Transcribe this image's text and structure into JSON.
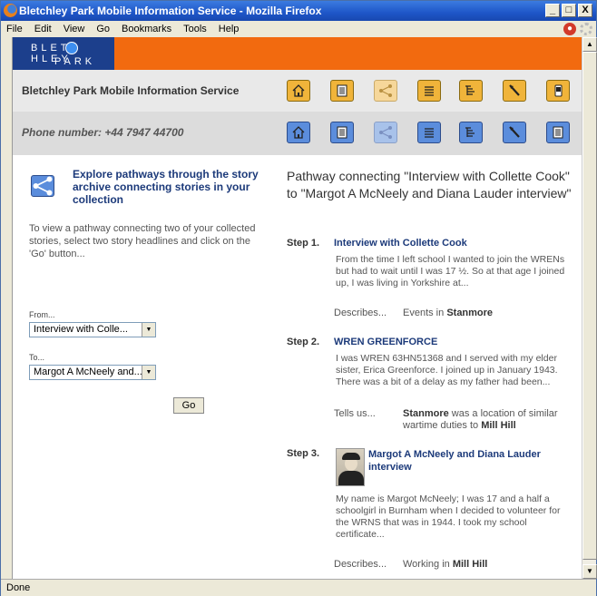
{
  "window": {
    "title": "Bletchley Park Mobile Information Service - Mozilla Firefox",
    "buttons": [
      "_",
      "□",
      "X"
    ]
  },
  "menu": [
    "File",
    "Edit",
    "View",
    "Go",
    "Bookmarks",
    "Tools",
    "Help"
  ],
  "status": "Done",
  "logo": {
    "line1": "BLET",
    "line1b": "HLEY",
    "line2": "PARK"
  },
  "header": {
    "service_name": "Bletchley Park Mobile Information Service",
    "phone": "Phone number: +44 7947 44700"
  },
  "nav_icons": [
    "home-icon",
    "document-icon",
    "pathway-icon",
    "list-icon",
    "tree-icon",
    "pointer-icon",
    "mobile-icon"
  ],
  "left": {
    "heading": "Explore pathways through the story archive connecting stories in your collection",
    "description": "To view a pathway connecting two of your collected stories, select two story headlines and click on the 'Go' button...",
    "from_label": "From...",
    "from_value": "Interview with Colle...",
    "to_label": "To...",
    "to_value": "Margot A McNeely and...",
    "go_label": "Go"
  },
  "right": {
    "title": "Pathway connecting \"Interview with Collette Cook\" to \"Margot A McNeely and Diana Lauder interview\"",
    "steps": [
      {
        "num": "Step 1.",
        "title": "Interview with Collette Cook",
        "body": "From the time I left school I wanted to join the WRENs but had to wait until I was 17 ½. So at that age I joined up, I was living in Yorkshire at...",
        "rel_verb": "Describes...",
        "rel_text": "Events in ",
        "rel_place": "Stanmore"
      },
      {
        "num": "Step 2.",
        "title": "WREN GREENFORCE",
        "body": "I was WREN 63HN51368 and I served with my elder sister, Erica Greenforce. I joined up in January 1943. There was a bit of a delay as my father had been...",
        "rel_verb": "Tells us...",
        "rel_place": "Stanmore",
        "rel_text": " was a location of similar wartime duties to ",
        "rel_place2": "Mill Hill"
      },
      {
        "num": "Step 3.",
        "title": "Margot A McNeely and Diana Lauder interview",
        "body": "My name is Margot McNeely; I was 17 and a half a schoolgirl in Burnham when I decided to volunteer for the WRNS that was in 1944. I took my school certificate...",
        "rel_verb": "Describes...",
        "rel_text": "Working in ",
        "rel_place": "Mill Hill"
      }
    ]
  }
}
